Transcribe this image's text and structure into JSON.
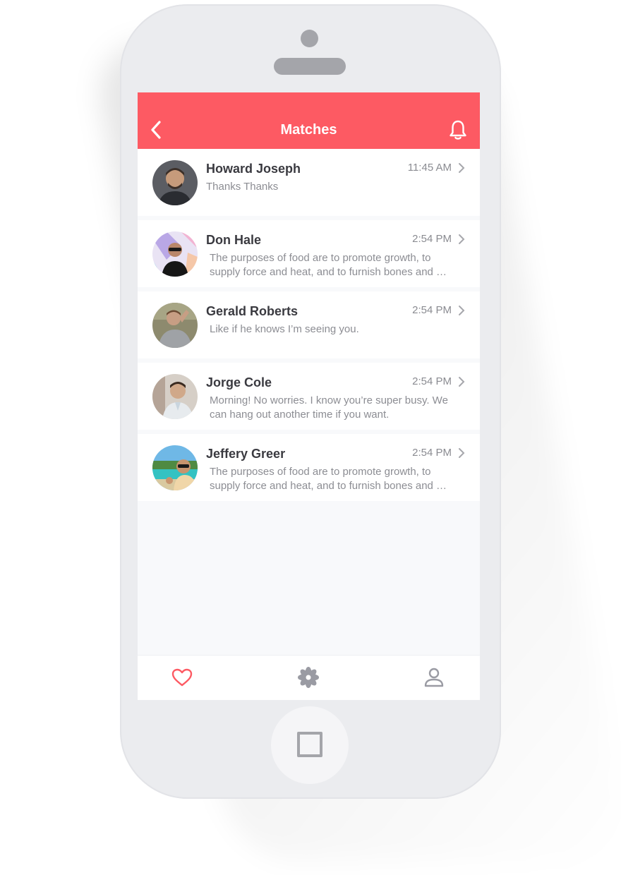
{
  "header": {
    "title": "Matches",
    "accent_color": "#fd5a63",
    "back_icon": "chevron-left-icon",
    "bell_icon": "bell-icon"
  },
  "matches": [
    {
      "name": "Howard Joseph",
      "time": "11:45 AM",
      "message": "Thanks Thanks"
    },
    {
      "name": "Don Hale",
      "time": "2:54 PM",
      "message": "The purposes of food are to promote growth, to supply force and heat, and to furnish bones and …"
    },
    {
      "name": "Gerald Roberts",
      "time": "2:54 PM",
      "message": "Like if he knows I’m seeing you."
    },
    {
      "name": "Jorge Cole",
      "time": "2:54 PM",
      "message": "Morning! No worries. I know you’re super busy. We can hang out another time if you want."
    },
    {
      "name": "Jeffery Greer",
      "time": "2:54 PM",
      "message": "The purposes of food are to promote growth, to supply force and heat, and to furnish bones and …"
    }
  ],
  "bottom_nav": {
    "items": [
      {
        "icon": "heart-icon",
        "active": true
      },
      {
        "icon": "flower-icon",
        "active": false
      },
      {
        "icon": "profile-icon",
        "active": false
      }
    ]
  }
}
